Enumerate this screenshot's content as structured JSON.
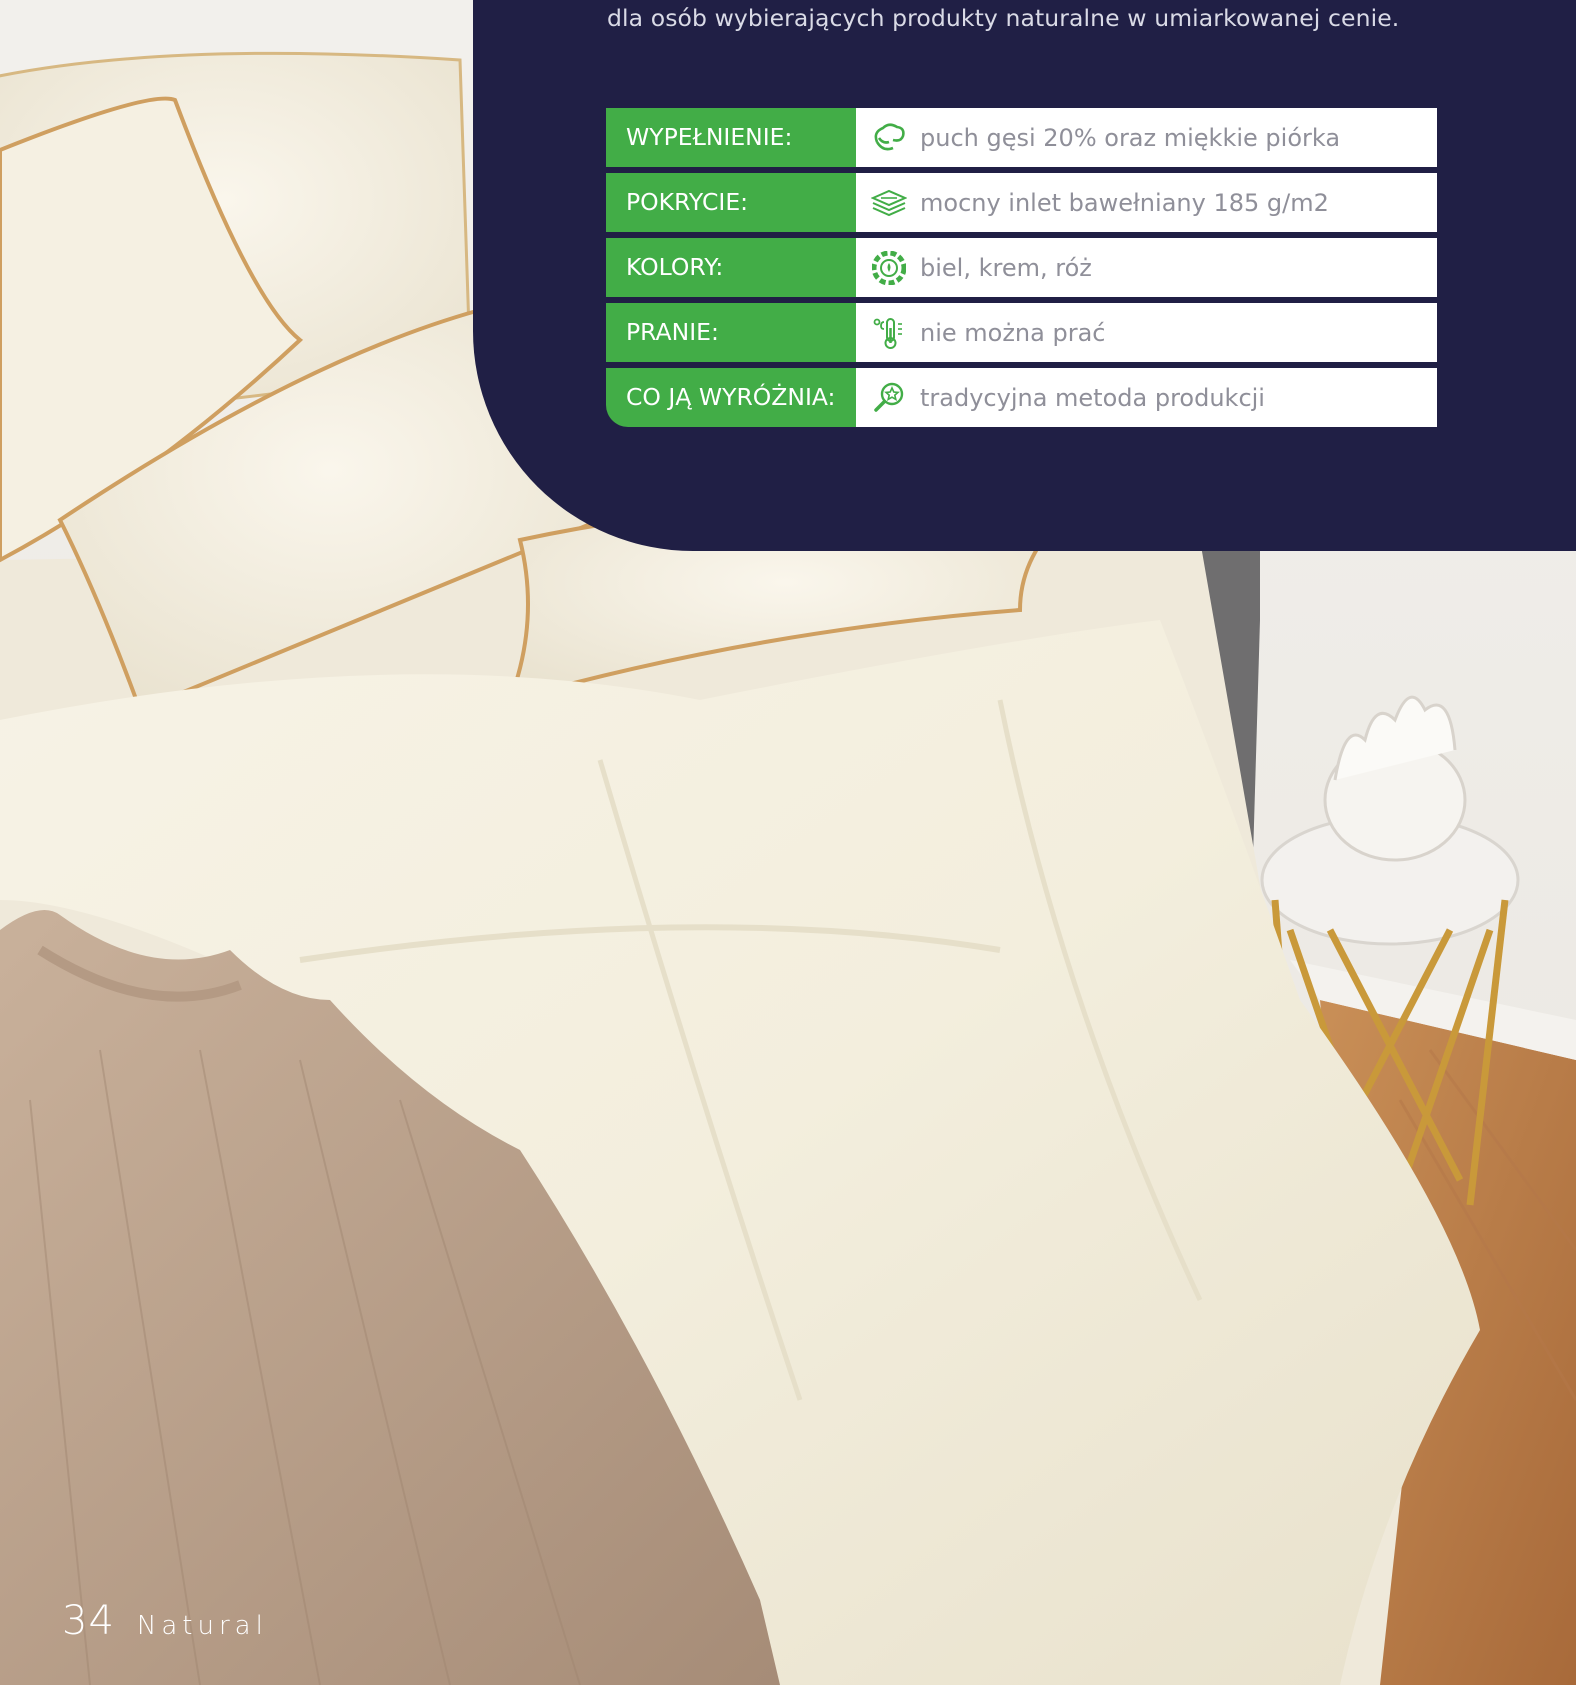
{
  "intro": {
    "text": "dla osób wybierających produkty naturalne w umiarkowanej cenie."
  },
  "specs": [
    {
      "label": "WYPEŁNIENIE:",
      "value": "puch gęsi 20% oraz miękkie piórka",
      "icon": "feather-down-icon"
    },
    {
      "label": "POKRYCIE:",
      "value": "mocny inlet bawełniany 185 g/m2",
      "icon": "fabric-layers-icon"
    },
    {
      "label": "KOLORY:",
      "value": "biel, krem, róż",
      "icon": "color-wheel-icon"
    },
    {
      "label": "PRANIE:",
      "value": "nie można prać",
      "icon": "thermometer-icon"
    },
    {
      "label": "CO JĄ WYRÓŻNIA:",
      "value": "tradycyjna metoda produkcji",
      "icon": "magnifier-star-icon"
    }
  ],
  "colors": {
    "panel": "#201f45",
    "label_green": "#42ad47",
    "icon_green": "#42ad47"
  },
  "footer": {
    "page_number": "34",
    "section": "Natural"
  }
}
